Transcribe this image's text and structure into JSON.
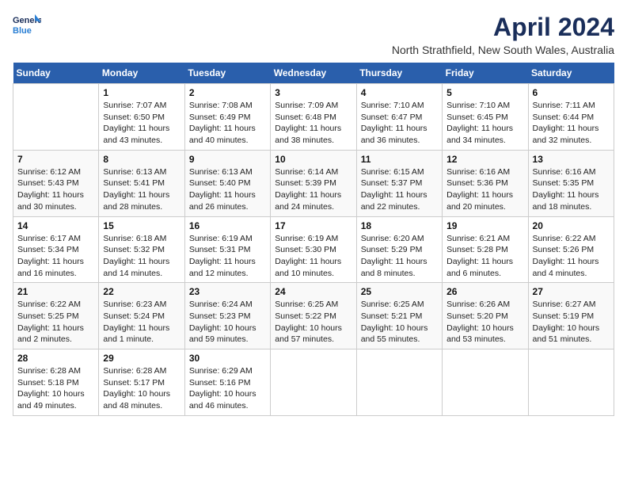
{
  "logo": {
    "line1": "General",
    "line2": "Blue"
  },
  "title": "April 2024",
  "location": "North Strathfield, New South Wales, Australia",
  "days_header": [
    "Sunday",
    "Monday",
    "Tuesday",
    "Wednesday",
    "Thursday",
    "Friday",
    "Saturday"
  ],
  "weeks": [
    [
      {
        "day": "",
        "info": ""
      },
      {
        "day": "1",
        "info": "Sunrise: 7:07 AM\nSunset: 6:50 PM\nDaylight: 11 hours\nand 43 minutes."
      },
      {
        "day": "2",
        "info": "Sunrise: 7:08 AM\nSunset: 6:49 PM\nDaylight: 11 hours\nand 40 minutes."
      },
      {
        "day": "3",
        "info": "Sunrise: 7:09 AM\nSunset: 6:48 PM\nDaylight: 11 hours\nand 38 minutes."
      },
      {
        "day": "4",
        "info": "Sunrise: 7:10 AM\nSunset: 6:47 PM\nDaylight: 11 hours\nand 36 minutes."
      },
      {
        "day": "5",
        "info": "Sunrise: 7:10 AM\nSunset: 6:45 PM\nDaylight: 11 hours\nand 34 minutes."
      },
      {
        "day": "6",
        "info": "Sunrise: 7:11 AM\nSunset: 6:44 PM\nDaylight: 11 hours\nand 32 minutes."
      }
    ],
    [
      {
        "day": "7",
        "info": "Sunrise: 6:12 AM\nSunset: 5:43 PM\nDaylight: 11 hours\nand 30 minutes."
      },
      {
        "day": "8",
        "info": "Sunrise: 6:13 AM\nSunset: 5:41 PM\nDaylight: 11 hours\nand 28 minutes."
      },
      {
        "day": "9",
        "info": "Sunrise: 6:13 AM\nSunset: 5:40 PM\nDaylight: 11 hours\nand 26 minutes."
      },
      {
        "day": "10",
        "info": "Sunrise: 6:14 AM\nSunset: 5:39 PM\nDaylight: 11 hours\nand 24 minutes."
      },
      {
        "day": "11",
        "info": "Sunrise: 6:15 AM\nSunset: 5:37 PM\nDaylight: 11 hours\nand 22 minutes."
      },
      {
        "day": "12",
        "info": "Sunrise: 6:16 AM\nSunset: 5:36 PM\nDaylight: 11 hours\nand 20 minutes."
      },
      {
        "day": "13",
        "info": "Sunrise: 6:16 AM\nSunset: 5:35 PM\nDaylight: 11 hours\nand 18 minutes."
      }
    ],
    [
      {
        "day": "14",
        "info": "Sunrise: 6:17 AM\nSunset: 5:34 PM\nDaylight: 11 hours\nand 16 minutes."
      },
      {
        "day": "15",
        "info": "Sunrise: 6:18 AM\nSunset: 5:32 PM\nDaylight: 11 hours\nand 14 minutes."
      },
      {
        "day": "16",
        "info": "Sunrise: 6:19 AM\nSunset: 5:31 PM\nDaylight: 11 hours\nand 12 minutes."
      },
      {
        "day": "17",
        "info": "Sunrise: 6:19 AM\nSunset: 5:30 PM\nDaylight: 11 hours\nand 10 minutes."
      },
      {
        "day": "18",
        "info": "Sunrise: 6:20 AM\nSunset: 5:29 PM\nDaylight: 11 hours\nand 8 minutes."
      },
      {
        "day": "19",
        "info": "Sunrise: 6:21 AM\nSunset: 5:28 PM\nDaylight: 11 hours\nand 6 minutes."
      },
      {
        "day": "20",
        "info": "Sunrise: 6:22 AM\nSunset: 5:26 PM\nDaylight: 11 hours\nand 4 minutes."
      }
    ],
    [
      {
        "day": "21",
        "info": "Sunrise: 6:22 AM\nSunset: 5:25 PM\nDaylight: 11 hours\nand 2 minutes."
      },
      {
        "day": "22",
        "info": "Sunrise: 6:23 AM\nSunset: 5:24 PM\nDaylight: 11 hours\nand 1 minute."
      },
      {
        "day": "23",
        "info": "Sunrise: 6:24 AM\nSunset: 5:23 PM\nDaylight: 10 hours\nand 59 minutes."
      },
      {
        "day": "24",
        "info": "Sunrise: 6:25 AM\nSunset: 5:22 PM\nDaylight: 10 hours\nand 57 minutes."
      },
      {
        "day": "25",
        "info": "Sunrise: 6:25 AM\nSunset: 5:21 PM\nDaylight: 10 hours\nand 55 minutes."
      },
      {
        "day": "26",
        "info": "Sunrise: 6:26 AM\nSunset: 5:20 PM\nDaylight: 10 hours\nand 53 minutes."
      },
      {
        "day": "27",
        "info": "Sunrise: 6:27 AM\nSunset: 5:19 PM\nDaylight: 10 hours\nand 51 minutes."
      }
    ],
    [
      {
        "day": "28",
        "info": "Sunrise: 6:28 AM\nSunset: 5:18 PM\nDaylight: 10 hours\nand 49 minutes."
      },
      {
        "day": "29",
        "info": "Sunrise: 6:28 AM\nSunset: 5:17 PM\nDaylight: 10 hours\nand 48 minutes."
      },
      {
        "day": "30",
        "info": "Sunrise: 6:29 AM\nSunset: 5:16 PM\nDaylight: 10 hours\nand 46 minutes."
      },
      {
        "day": "",
        "info": ""
      },
      {
        "day": "",
        "info": ""
      },
      {
        "day": "",
        "info": ""
      },
      {
        "day": "",
        "info": ""
      }
    ]
  ]
}
